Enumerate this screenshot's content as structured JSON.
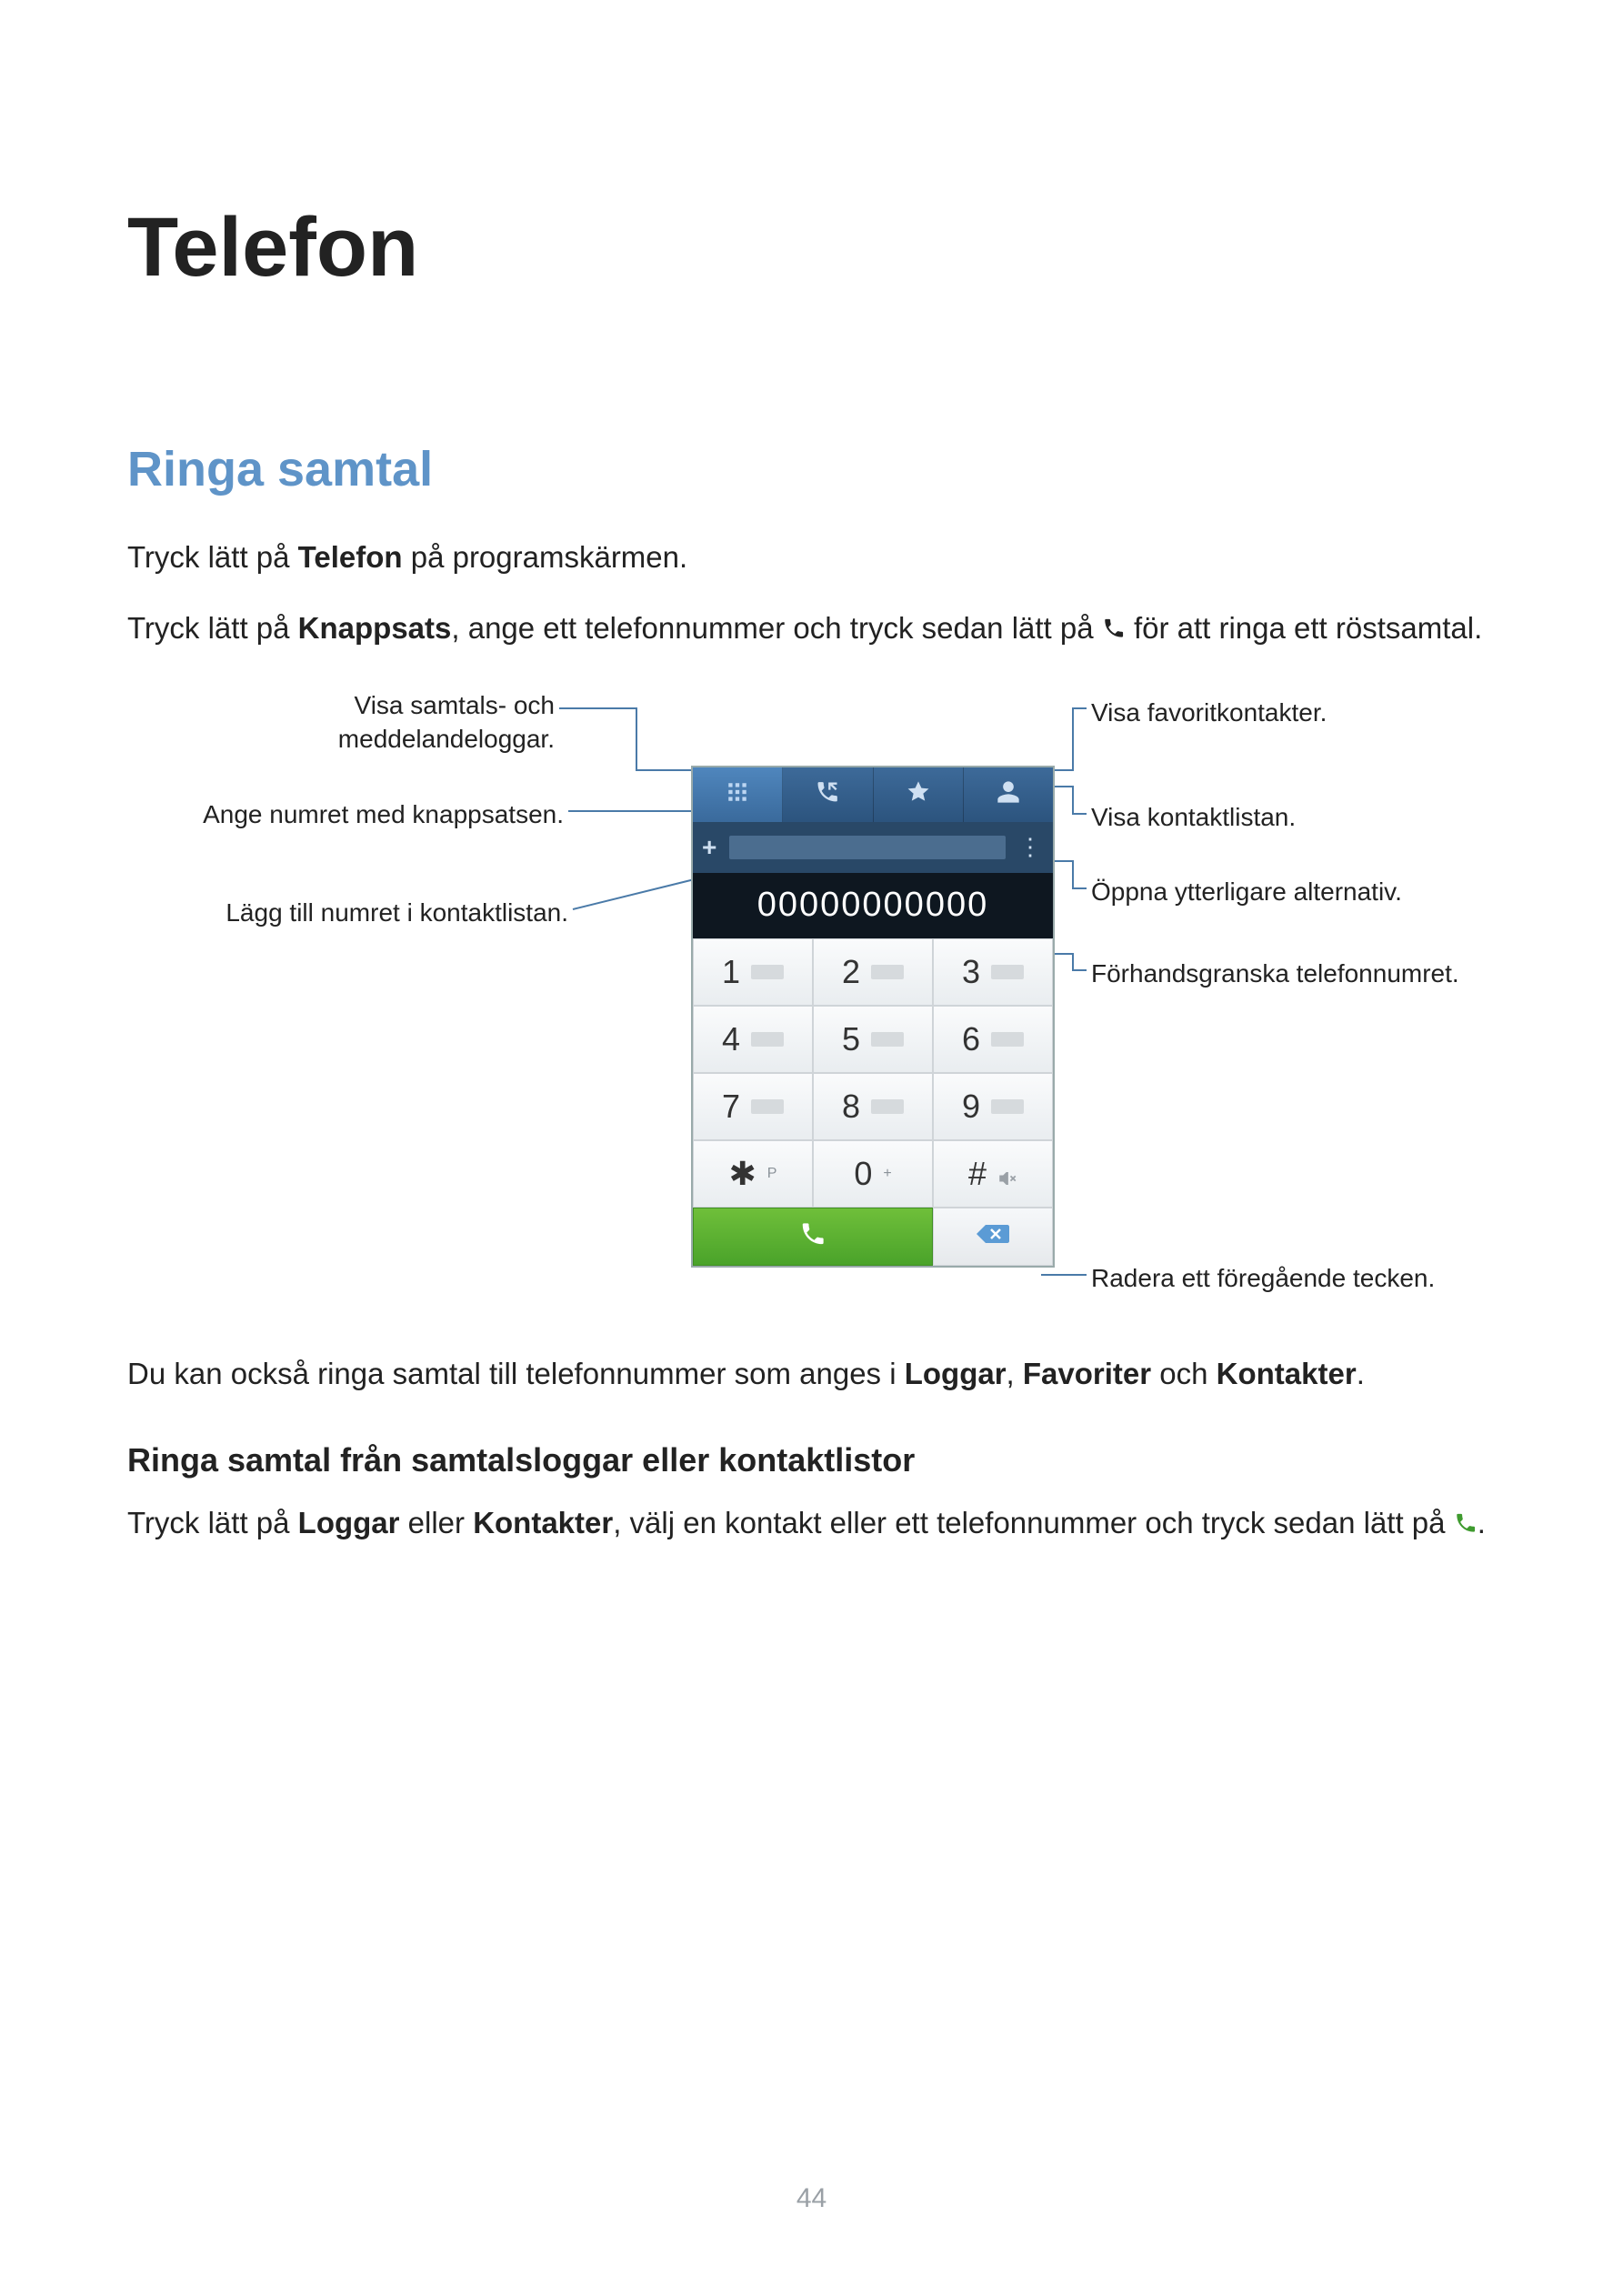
{
  "title": "Telefon",
  "section": "Ringa samtal",
  "p1_a": "Tryck lätt på ",
  "p1_b": "Telefon",
  "p1_c": " på programskärmen.",
  "p2_a": "Tryck lätt på ",
  "p2_b": "Knappsats",
  "p2_c": ", ange ett telefonnummer och tryck sedan lätt på ",
  "p2_d": " för att ringa ett röstsamtal.",
  "callouts": {
    "logs": "Visa samtals- och\nmeddelandeloggar.",
    "keypad": "Ange numret med knappsatsen.",
    "add": "Lägg till numret i kontaktlistan.",
    "fav": "Visa favoritkontakter.",
    "contacts": "Visa kontaktlistan.",
    "more": "Öppna ytterligare alternativ.",
    "preview": "Förhandsgranska telefonnumret.",
    "delete": "Radera ett föregående tecken."
  },
  "display_number": "00000000000",
  "keys": {
    "k1": "1",
    "k2": "2",
    "k3": "3",
    "k4": "4",
    "k5": "5",
    "k6": "6",
    "k7": "7",
    "k8": "8",
    "k9": "9",
    "star": "✱",
    "star_sub": "P",
    "k0": "0",
    "k0_sub": "+",
    "hash": "#"
  },
  "p3_a": "Du kan också ringa samtal till telefonnummer som anges i ",
  "p3_b": "Loggar",
  "p3_c": ", ",
  "p3_d": "Favoriter",
  "p3_e": " och ",
  "p3_f": "Kontakter",
  "p3_g": ".",
  "sub_heading": "Ringa samtal från samtalsloggar eller kontaktlistor",
  "p4_a": "Tryck lätt på ",
  "p4_b": "Loggar",
  "p4_c": " eller ",
  "p4_d": "Kontakter",
  "p4_e": ", välj en kontakt eller ett telefonnummer och tryck sedan lätt på ",
  "p4_f": ".",
  "page_number": "44"
}
